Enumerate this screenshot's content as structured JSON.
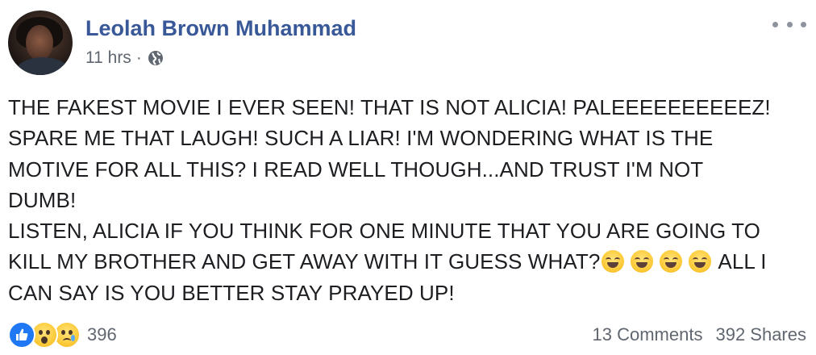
{
  "post": {
    "author": "Leolah Brown Muhammad",
    "time": "11 hrs",
    "separator": "·",
    "privacy_icon": "globe-icon",
    "more_icon": "more-options-icon",
    "body_lines": [
      "THE FAKEST MOVIE I EVER SEEN! THAT IS NOT ALICIA! PALEEEEEEEEEEZ!",
      "SPARE ME THAT LAUGH! SUCH A LIAR! I'M WONDERING WHAT IS THE",
      "MOTIVE FOR ALL THIS? I READ WELL THOUGH...AND TRUST I'M NOT",
      "DUMB!",
      "LISTEN, ALICIA IF YOU THINK FOR ONE MINUTE THAT YOU ARE GOING TO"
    ],
    "line6_text": "KILL MY BROTHER AND GET AWAY WITH IT GUESS WHAT?",
    "line6_emoji_count": 4,
    "line6_tail": "ALL I",
    "line7_text": "CAN SAY IS YOU BETTER STAY PRAYED UP!",
    "emoji_icon": "grinning-face-icon"
  },
  "footer": {
    "reaction_icons": [
      "like-icon",
      "wow-icon",
      "sad-icon"
    ],
    "reaction_count": "396",
    "comments": "13 Comments",
    "shares": "392 Shares"
  },
  "colors": {
    "author_link": "#385898",
    "meta_text": "#606770",
    "like_blue": "#2078f4"
  }
}
